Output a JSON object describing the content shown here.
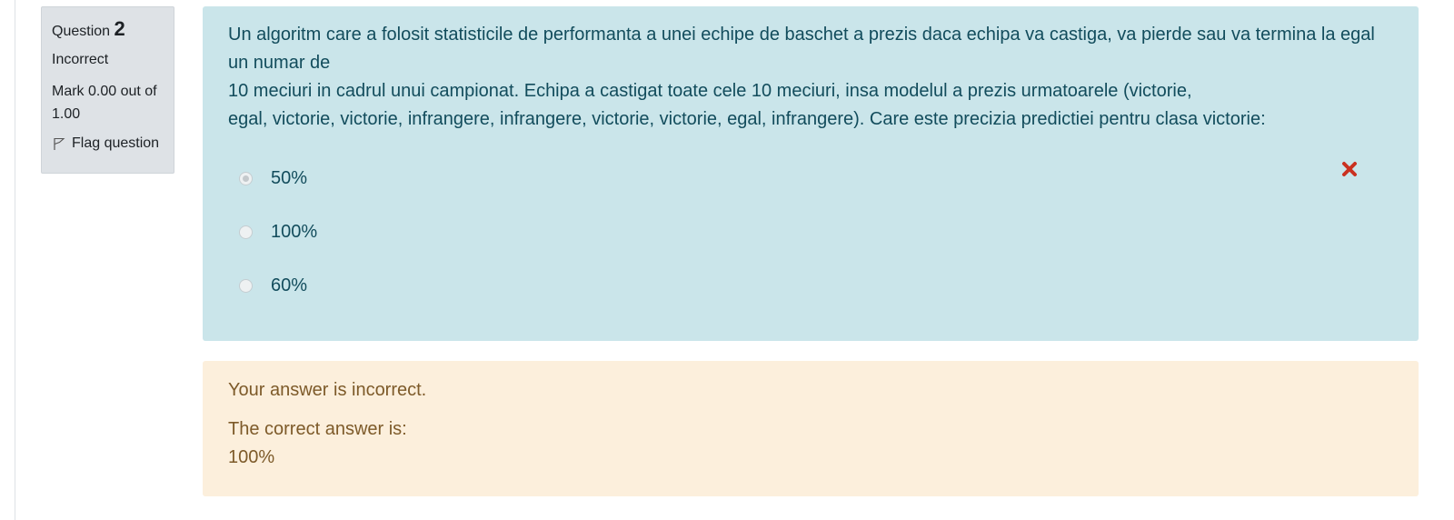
{
  "info": {
    "question_label": "Question",
    "question_number": "2",
    "state": "Incorrect",
    "grade_line1": "Mark 0.00 out of",
    "grade_line2": "1.00",
    "flag_label": "Flag question"
  },
  "question": {
    "text_lines": [
      "Un algoritm care a folosit statisticile de performanta a unei echipe de baschet a prezis daca echipa va castiga, va pierde sau va termina la egal un numar de",
      "10 meciuri in cadrul unui campionat. Echipa a castigat toate cele 10 meciuri, insa modelul a prezis urmatoarele (victorie,",
      "egal, victorie, victorie, infrangere, infrangere, victorie, victorie, egal, infrangere). Care este precizia predictiei pentru clasa victorie:"
    ],
    "answers": [
      {
        "label": "50%",
        "selected": true,
        "marked_wrong": true
      },
      {
        "label": "100%",
        "selected": false,
        "marked_wrong": false
      },
      {
        "label": "60%",
        "selected": false,
        "marked_wrong": false
      }
    ],
    "wrong_icon": "cross-icon"
  },
  "feedback": {
    "message": "Your answer is incorrect.",
    "correct_label": "The correct answer is:",
    "correct_value": "100%"
  },
  "colors": {
    "formulation_bg": "#cae5ea",
    "formulation_text": "#124c5c",
    "outcome_bg": "#fcefdc",
    "outcome_text": "#7d5a29",
    "info_bg": "#dee2e6",
    "wrong_mark": "#ca3120"
  }
}
